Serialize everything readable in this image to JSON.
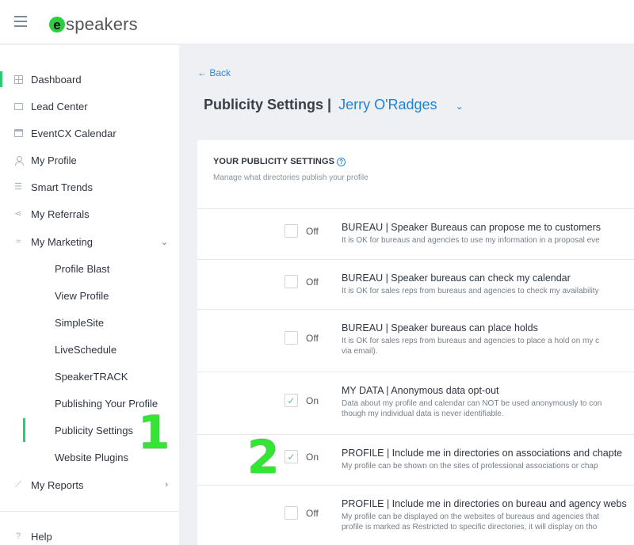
{
  "app": {
    "logo_letter": "e",
    "logo_text": "speakers"
  },
  "sidebar": {
    "items": [
      {
        "label": "Dashboard",
        "icon": "grid-icon"
      },
      {
        "label": "Lead Center",
        "icon": "lead-icon"
      },
      {
        "label": "EventCX Calendar",
        "icon": "calendar-icon"
      },
      {
        "label": "My Profile",
        "icon": "user-icon"
      },
      {
        "label": "Smart Trends",
        "icon": "trends-icon"
      },
      {
        "label": "My Referrals",
        "icon": "share-icon"
      },
      {
        "label": "My Marketing",
        "icon": "marketing-icon",
        "chevron": "⌄"
      }
    ],
    "sub_items": [
      "Profile Blast",
      "View Profile",
      "SimpleSite",
      "LiveSchedule",
      "SpeakerTRACK",
      "Publishing Your Profile",
      "Publicity Settings",
      "Website Plugins"
    ],
    "reports": {
      "label": "My Reports",
      "chevron": "›"
    },
    "help": {
      "label": "Help"
    }
  },
  "main": {
    "back_label": "← Back",
    "title": "Publicity Settings |",
    "speaker_name": "Jerry O'Radges",
    "caret": "⌄",
    "card": {
      "title": "YOUR PUBLICITY SETTINGS",
      "help": "?",
      "subtitle": "Manage what directories publish your profile",
      "rows": [
        {
          "state": "Off",
          "checked": "",
          "title": "BUREAU | Speaker Bureaus can propose me to customers",
          "desc": "It is OK for bureaus and agencies to use my information in a proposal eve"
        },
        {
          "state": "Off",
          "checked": "",
          "title": "BUREAU | Speaker bureaus can check my calendar",
          "desc": "It is OK for sales reps from bureaus and agencies to check my availability"
        },
        {
          "state": "Off",
          "checked": "",
          "title": "BUREAU | Speaker bureaus can place holds",
          "desc": "It is OK for sales reps from bureaus and agencies to place a hold on my c",
          "desc2": "via email)."
        },
        {
          "state": "On",
          "checked": "✓",
          "title": "MY DATA | Anonymous data opt-out",
          "desc": "Data about my profile and calendar can NOT be used anonymously to con",
          "desc2": "though my individual data is never identifiable."
        },
        {
          "state": "On",
          "checked": "✓",
          "title": "PROFILE | Include me in directories on associations and chapte",
          "desc": "My profile can be shown on the sites of professional associations or chap"
        },
        {
          "state": "Off",
          "checked": "",
          "title": "PROFILE | Include me in directories on bureau and agency webs",
          "desc": "My profile can be displayed on the websites of bureaus and agencies that",
          "desc2": "profile is marked as Restricted to specific directories, it will display on tho"
        }
      ]
    }
  },
  "annotations": {
    "first": "1",
    "second": "2"
  }
}
